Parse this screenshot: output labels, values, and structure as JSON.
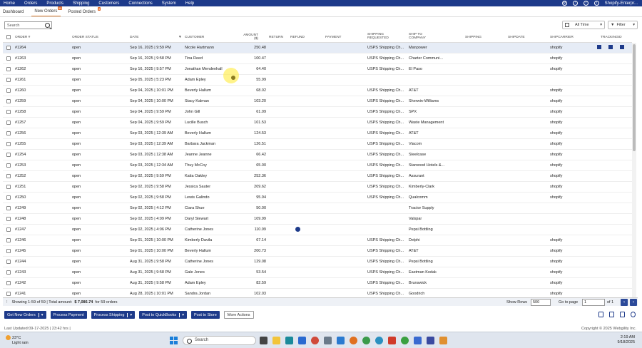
{
  "topnav": {
    "menu": [
      "Home",
      "Orders",
      "Products",
      "Shipping",
      "Customers",
      "Connections",
      "System",
      "Help"
    ],
    "account": "Shopify-Enterpr..."
  },
  "tabs": [
    {
      "label": "Dashboard",
      "badge": ""
    },
    {
      "label": "New Orders",
      "badge": "59"
    },
    {
      "label": "Posted Orders",
      "badge": "3"
    }
  ],
  "search": {
    "placeholder": "Search"
  },
  "date_filter": {
    "value": "All Time"
  },
  "filter_button": {
    "label": "Filter"
  },
  "columns": [
    "ORDER #",
    "ORDER STATUS",
    "DATE",
    "CUSTOMER",
    "AMOUNT ($)",
    "RETURN",
    "REFUND",
    "PAYMENT",
    "SHIPPING REQUESTED",
    "SHIP TO COMPANY",
    "SHIPPING",
    "SHIPDATE",
    "SHIPCARRIER",
    "TRACKINGID"
  ],
  "orders": [
    {
      "num": "#1264",
      "status": "open",
      "date": "Sep 16, 2025 | 9:59 PM",
      "customer": "Nicole Hartmann",
      "amount": "250.48",
      "shipreq": "USPS Shipping Ch...",
      "company": "Manpower",
      "carrier": "shopify",
      "payment_icon": false
    },
    {
      "num": "#1263",
      "status": "open",
      "date": "Sep 16, 2025 | 9:58 PM",
      "customer": "Tina Reed",
      "amount": "100.47",
      "shipreq": "USPS Shipping Ch...",
      "company": "Charter Communi...",
      "carrier": "shopify",
      "payment_icon": false
    },
    {
      "num": "#1262",
      "status": "open",
      "date": "Sep 16, 2025 | 9:57 PM",
      "customer": "Jonathan Mendenhall",
      "amount": "64.40",
      "shipreq": "USPS Shipping Ch...",
      "company": "El Paso",
      "carrier": "shopify",
      "payment_icon": false
    },
    {
      "num": "#1261",
      "status": "open",
      "date": "Sep 05, 2025 | 5:23 PM",
      "customer": "Adam Epley",
      "amount": "55.99",
      "shipreq": "",
      "company": "",
      "carrier": "",
      "payment_icon": false
    },
    {
      "num": "#1260",
      "status": "open",
      "date": "Sep 04, 2025 | 10:01 PM",
      "customer": "Beverly Hallum",
      "amount": "68.02",
      "shipreq": "USPS Shipping Ch...",
      "company": "AT&T",
      "carrier": "shopify",
      "payment_icon": false
    },
    {
      "num": "#1259",
      "status": "open",
      "date": "Sep 04, 2025 | 10:00 PM",
      "customer": "Stacy Kalman",
      "amount": "103.20",
      "shipreq": "USPS Shipping Ch...",
      "company": "Sherwin-Williams",
      "carrier": "shopify",
      "payment_icon": false
    },
    {
      "num": "#1258",
      "status": "open",
      "date": "Sep 04, 2025 | 9:59 PM",
      "customer": "John Gill",
      "amount": "61.09",
      "shipreq": "USPS Shipping Ch...",
      "company": "SPX",
      "carrier": "shopify",
      "payment_icon": false
    },
    {
      "num": "#1257",
      "status": "open",
      "date": "Sep 04, 2025 | 9:59 PM",
      "customer": "Lucille Busch",
      "amount": "101.53",
      "shipreq": "USPS Shipping Ch...",
      "company": "Waste Management",
      "carrier": "shopify",
      "payment_icon": false
    },
    {
      "num": "#1256",
      "status": "open",
      "date": "Sep 03, 2025 | 12:39 AM",
      "customer": "Beverly Hallum",
      "amount": "124.53",
      "shipreq": "USPS Shipping Ch...",
      "company": "AT&T",
      "carrier": "shopify",
      "payment_icon": false
    },
    {
      "num": "#1255",
      "status": "open",
      "date": "Sep 03, 2025 | 12:39 AM",
      "customer": "Barbara Jackman",
      "amount": "126.51",
      "shipreq": "USPS Shipping Ch...",
      "company": "Viacom",
      "carrier": "shopify",
      "payment_icon": false
    },
    {
      "num": "#1254",
      "status": "open",
      "date": "Sep 03, 2025 | 12:38 AM",
      "customer": "Jeanne Jeanne",
      "amount": "66.42",
      "shipreq": "USPS Shipping Ch...",
      "company": "Steelcase",
      "carrier": "shopify",
      "payment_icon": false
    },
    {
      "num": "#1253",
      "status": "open",
      "date": "Sep 03, 2025 | 12:34 AM",
      "customer": "Thuy McCoy",
      "amount": "65.00",
      "shipreq": "USPS Shipping Ch...",
      "company": "Starwood Hotels &...",
      "carrier": "shopify",
      "payment_icon": false
    },
    {
      "num": "#1252",
      "status": "open",
      "date": "Sep 02, 2025 | 9:59 PM",
      "customer": "Katia Oakley",
      "amount": "252.36",
      "shipreq": "USPS Shipping Ch...",
      "company": "Assurant",
      "carrier": "shopify",
      "payment_icon": false
    },
    {
      "num": "#1251",
      "status": "open",
      "date": "Sep 02, 2025 | 9:58 PM",
      "customer": "Jessica Sauter",
      "amount": "209.62",
      "shipreq": "USPS Shipping Ch...",
      "company": "Kimberly-Clark",
      "carrier": "shopify",
      "payment_icon": false
    },
    {
      "num": "#1250",
      "status": "open",
      "date": "Sep 02, 2025 | 9:58 PM",
      "customer": "Lewis Galindo",
      "amount": "95.94",
      "shipreq": "USPS Shipping Ch...",
      "company": "Qualcomm",
      "carrier": "shopify",
      "payment_icon": false
    },
    {
      "num": "#1249",
      "status": "open",
      "date": "Sep 02, 2025 | 4:12 PM",
      "customer": "Ciara Shue",
      "amount": "50.00",
      "shipreq": "",
      "company": "Tractor Supply",
      "carrier": "",
      "payment_icon": false
    },
    {
      "num": "#1248",
      "status": "open",
      "date": "Sep 02, 2025 | 4:09 PM",
      "customer": "Daryl Stewart",
      "amount": "109.99",
      "shipreq": "",
      "company": "Valspar",
      "carrier": "",
      "payment_icon": false
    },
    {
      "num": "#1247",
      "status": "open",
      "date": "Sep 02, 2025 | 4:06 PM",
      "customer": "Catherine Jones",
      "amount": "110.99",
      "shipreq": "",
      "company": "Pepsi Bottling",
      "carrier": "",
      "payment_icon": true
    },
    {
      "num": "#1246",
      "status": "open",
      "date": "Sep 01, 2025 | 10:00 PM",
      "customer": "Kimberly Davila",
      "amount": "67.14",
      "shipreq": "USPS Shipping Ch...",
      "company": "Delphi",
      "carrier": "shopify",
      "payment_icon": false
    },
    {
      "num": "#1245",
      "status": "open",
      "date": "Sep 01, 2025 | 10:00 PM",
      "customer": "Beverly Hallum",
      "amount": "200.73",
      "shipreq": "USPS Shipping Ch...",
      "company": "AT&T",
      "carrier": "shopify",
      "payment_icon": false
    },
    {
      "num": "#1244",
      "status": "open",
      "date": "Aug 31, 2025 | 9:58 PM",
      "customer": "Catherine Jones",
      "amount": "129.08",
      "shipreq": "USPS Shipping Ch...",
      "company": "Pepsi Bottling",
      "carrier": "shopify",
      "payment_icon": false
    },
    {
      "num": "#1243",
      "status": "open",
      "date": "Aug 31, 2025 | 9:58 PM",
      "customer": "Gale Jones",
      "amount": "53.54",
      "shipreq": "USPS Shipping Ch...",
      "company": "Eastman Kodak",
      "carrier": "shopify",
      "payment_icon": false
    },
    {
      "num": "#1242",
      "status": "open",
      "date": "Aug 31, 2025 | 9:58 PM",
      "customer": "Adam Epley",
      "amount": "82.59",
      "shipreq": "USPS Shipping Ch...",
      "company": "Brunswick",
      "carrier": "shopify",
      "payment_icon": false
    },
    {
      "num": "#1241",
      "status": "open",
      "date": "Aug 28, 2025 | 10:01 PM",
      "customer": "Sandra Jordan",
      "amount": "102.03",
      "shipreq": "USPS Shipping Ch...",
      "company": "Goodrich",
      "carrier": "shopify",
      "payment_icon": false
    }
  ],
  "footer": {
    "showing": "Showing 1-59 of 59 | Total amount:",
    "total": "$ 7,086.74",
    "for_orders": "for 59 orders",
    "show_rows_label": "Show Rows",
    "show_rows_value": "500",
    "go_to_page_label": "Go to page",
    "page_value": "1",
    "of_pages": "of 1"
  },
  "actions": {
    "get_new_orders": "Get New Orders",
    "process_payment": "Process Payment",
    "process_shipping": "Process Shipping",
    "post_to_quickbooks": "Post to QuickBooks",
    "post_to_store": "Post to Store",
    "more_actions": "More Actions"
  },
  "status": {
    "last_updated": "Last Updated:09-17-2025 | 23:42 hrs |",
    "copyright": "Copyright © 2025 Webgility Inc."
  },
  "taskbar": {
    "temperature": "23°C",
    "weather": "Light rain",
    "search_placeholder": "Search",
    "time": "2:19 AM",
    "date": "9/18/2025"
  },
  "colors": {
    "primary": "#1d3a8a",
    "accent": "#e08030",
    "selected_row": "#e6ecf6"
  }
}
